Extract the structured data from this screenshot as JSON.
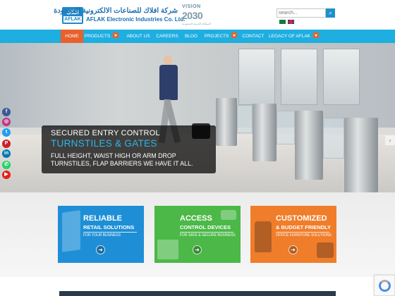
{
  "header": {
    "logo": {
      "arabic": "افلاك",
      "latin": "AFLAK"
    },
    "company_name_ar": "شركة افلاك للصناعات الالكترونية المحدودة",
    "company_name_en": "AFLAK Electronic Industries Co. Ltd.",
    "vision_badge": {
      "top": "VISION",
      "year": "2030",
      "sub": "المملكة العربية السعودية"
    },
    "search": {
      "placeholder": "search..."
    }
  },
  "nav": {
    "items": [
      {
        "label": "HOME",
        "active": true
      },
      {
        "label": "PRODUCTS",
        "dropdown": true
      },
      {
        "label": "ABOUT US"
      },
      {
        "label": "CAREERS"
      },
      {
        "label": "BLOG"
      },
      {
        "label": "PROJECTS",
        "dropdown": true
      },
      {
        "label": "CONTACT"
      },
      {
        "label": "LEGACY OF AFLAK",
        "dropdown": true
      }
    ]
  },
  "hero": {
    "line1": "SECURED ENTRY CONTROL",
    "line2": "TURNSTILES & GATES",
    "line3": "FULL HEIGHT, WAIST HIGH OR ARM DROP TURNSTILES, FLAP BARRIERS WE HAVE IT ALL.",
    "prev_glyph": "‹",
    "next_glyph": "›"
  },
  "social": [
    {
      "icon": "facebook-icon",
      "glyph": "f",
      "color": "#3b5998"
    },
    {
      "icon": "instagram-icon",
      "glyph": "◎",
      "color": "#c13584"
    },
    {
      "icon": "twitter-icon",
      "glyph": "t",
      "color": "#1da1f2"
    },
    {
      "icon": "pinterest-icon",
      "glyph": "P",
      "color": "#cb2027"
    },
    {
      "icon": "linkedin-icon",
      "glyph": "in",
      "color": "#0077b5"
    },
    {
      "icon": "whatsapp-icon",
      "glyph": "✆",
      "color": "#25d366"
    },
    {
      "icon": "youtube-icon",
      "glyph": "▶",
      "color": "#e62117"
    }
  ],
  "features": [
    {
      "title": "RELIABLE",
      "subtitle": "RETAIL SOLUTIONS",
      "desc": "FOR YOUR BUSINESS",
      "color": "#1e8fd6",
      "arrow": "➜"
    },
    {
      "title": "ACCESS",
      "subtitle": "CONTROL DEVICES",
      "desc": "FOR SAFE & SECURE BUSINESS",
      "color": "#4bb848",
      "arrow": "➜"
    },
    {
      "title": "CUSTOMIZED",
      "subtitle": "& BUDGET FRIENDLY",
      "desc": "OFFICE FURNITURE SOLUTIONS",
      "color": "#f07d2a",
      "arrow": "➜"
    }
  ],
  "colors": {
    "nav_bg": "#1eaee0",
    "nav_active": "#e8612c",
    "hero_accent": "#2bb7ea"
  }
}
